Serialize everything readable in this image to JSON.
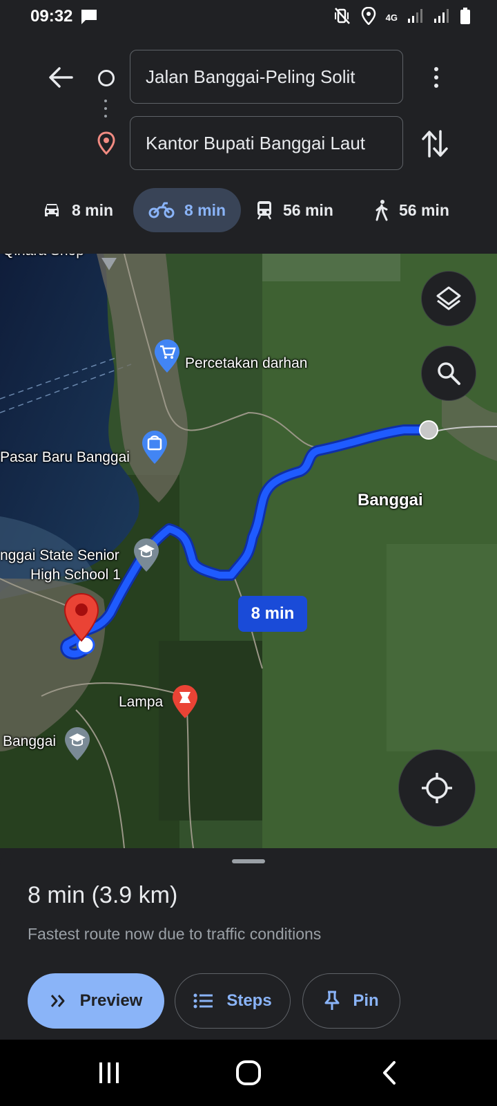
{
  "status": {
    "time": "09:32",
    "network": "4G"
  },
  "search": {
    "origin": "Jalan Banggai-Peling Solit",
    "destination": "Kantor Bupati Banggai Laut"
  },
  "modes": [
    {
      "name": "car",
      "label": "8 min",
      "selected": false
    },
    {
      "name": "motorcycle",
      "label": "8 min",
      "selected": true
    },
    {
      "name": "transit",
      "label": "56 min",
      "selected": false
    },
    {
      "name": "walk",
      "label": "56 min",
      "selected": false
    }
  ],
  "map": {
    "labels": {
      "qinara": "Qinara Shop",
      "percetakan": "Percetakan darhan",
      "pasar": "Pasar Baru Banggai",
      "banggai_region": "Banggai",
      "school_line1": "nggai State Senior",
      "school_line2": "High School 1",
      "lampa": "Lampa",
      "banggai_school": "Banggai"
    },
    "route_eta": "8 min",
    "colors": {
      "route": "#1a4bd8",
      "destination_pin": "#ea4335"
    }
  },
  "sheet": {
    "title": "8 min (3.9 km)",
    "subtitle": "Fastest route now due to traffic conditions",
    "preview_label": "Preview",
    "steps_label": "Steps",
    "pin_label": "Pin"
  },
  "colors": {
    "accent": "#8ab4f8",
    "background": "#202124"
  }
}
